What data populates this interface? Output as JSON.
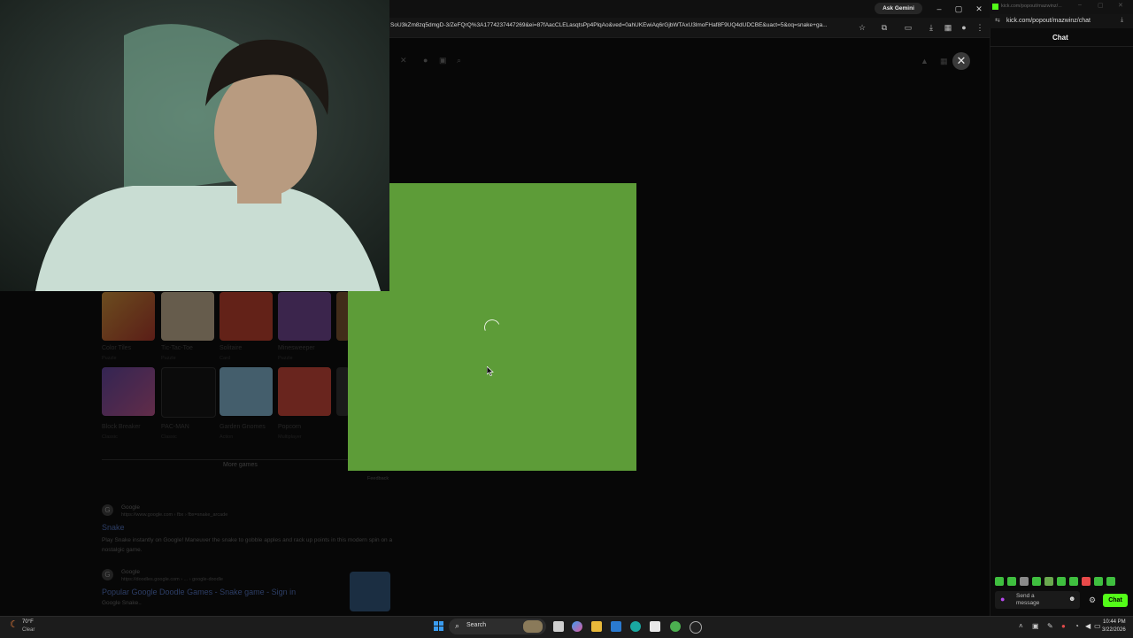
{
  "browser": {
    "url": "SoU3kZm8zq5dmgD-3/ZeFQrQ%3A1774237447269&ei=87fAacCLELasqtsPp4PlqAo&ved=0ahUKEwiAq6rGjbWTAxU3lmoFHaf8F9UQ4dUDCBE&uact=5&oq=snake+ga...",
    "ask_gemini": "Ask Gemini",
    "close_symbol": "✕"
  },
  "games": {
    "row1": [
      {
        "title": "Color Tiles",
        "sub": "Puzzle"
      },
      {
        "title": "Tic-Tac-Toe",
        "sub": "Puzzle"
      },
      {
        "title": "Solitaire",
        "sub": "Card"
      },
      {
        "title": "Minesweeper",
        "sub": "Puzzle"
      }
    ],
    "row2": [
      {
        "title": "Block Breaker",
        "sub": "Classic"
      },
      {
        "title": "PAC-MAN",
        "sub": "Classic"
      },
      {
        "title": "Garden Gnomes",
        "sub": "Action"
      },
      {
        "title": "Popcorn",
        "sub": "Multiplayer"
      }
    ],
    "more_games": "More games",
    "feedback": "Feedback"
  },
  "results": [
    {
      "source": "Google",
      "url": "https://www.google.com › fbx › fbx=snake_arcade",
      "title": "Snake",
      "snippet": "Play Snake instantly on Google! Maneuver the snake to gobble apples and rack up points in this modern spin on a nostalgic game."
    },
    {
      "source": "Google",
      "url": "https://doodles.google.com › ... › google-doodle",
      "title": "Popular Google Doodle Games - Snake game - Sign in",
      "snippet": "Google Snake.."
    }
  ],
  "chat": {
    "window_title": "kick.com/popout/mazwinz/...",
    "url": "kick.com/popout/mazwinz/chat",
    "header": "Chat",
    "send_placeholder": "Send a message",
    "chat_button": "Chat"
  },
  "taskbar": {
    "weather_temp": "70°F",
    "weather_desc": "Clear",
    "search_label": "Search",
    "time": "10:44 PM",
    "date": "3/22/2026"
  }
}
